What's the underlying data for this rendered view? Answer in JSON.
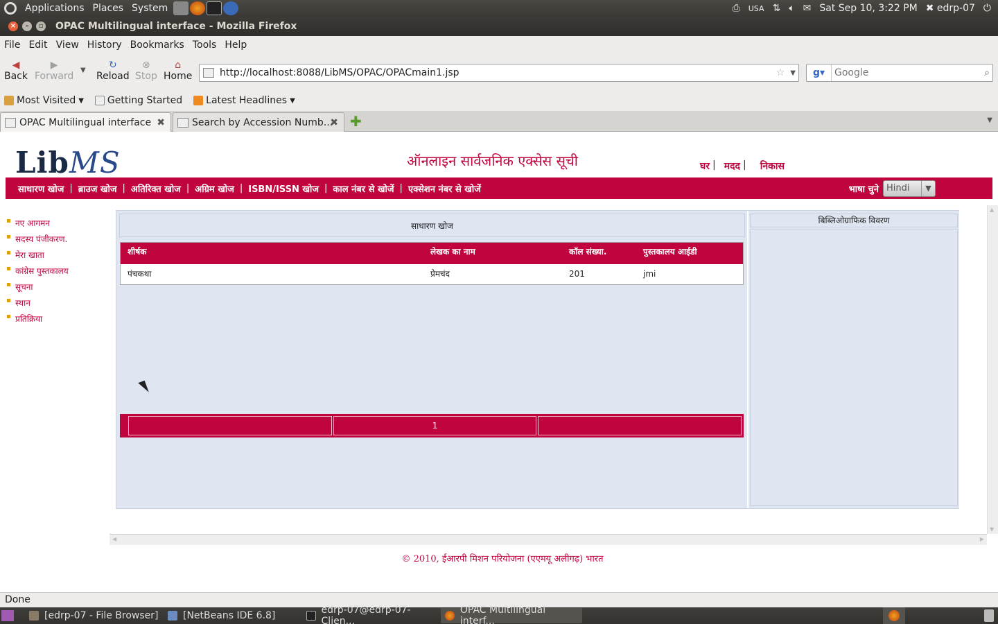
{
  "top_panel": {
    "menus": [
      "Applications",
      "Places",
      "System"
    ],
    "keyboard_layout": "USA",
    "datetime": "Sat Sep 10,  3:22 PM",
    "user": "edrp-07"
  },
  "window": {
    "title": "OPAC Multilingual interface - Mozilla Firefox"
  },
  "firefox": {
    "menu": [
      "File",
      "Edit",
      "View",
      "History",
      "Bookmarks",
      "Tools",
      "Help"
    ],
    "nav": {
      "back": "Back",
      "forward": "Forward",
      "reload": "Reload",
      "stop": "Stop",
      "home": "Home"
    },
    "url": "http://localhost:8088/LibMS/OPAC/OPACmain1.jsp",
    "search_placeholder": "Google",
    "bookmarks": [
      "Most Visited",
      "Getting Started",
      "Latest Headlines"
    ],
    "tabs": [
      {
        "label": "OPAC Multilingual interface",
        "active": true
      },
      {
        "label": "Search by Accession Numb...",
        "active": false
      }
    ],
    "status": "Done"
  },
  "page": {
    "logo": {
      "lib": "Lib",
      "ms": "MS"
    },
    "title": "ऑनलाइन सार्वजनिक एक्सेस सूची",
    "top_links": [
      "घर",
      "मदद",
      "निकास"
    ],
    "nav": [
      "साधारण खोज",
      "ब्राउज खोज",
      "अतिरिक्त खोज",
      "अग्रिम खोज",
      "ISBN/ISSN खोज",
      "काल नंबर से खोजें",
      "एक्सेशन नंबर से खोजें"
    ],
    "language_label": "भाषा चुने",
    "language_selected": "Hindi",
    "sidebar": [
      "नए आगमन",
      "सदस्य पंजीकरण.",
      "मेरा खाता",
      "कांग्रेस पुस्तकालय",
      "सूचना",
      "स्थान",
      "प्रतिक्रिया"
    ],
    "search_header": "साधारण खोज",
    "results": {
      "columns": [
        "शीर्षक",
        "लेखक का नाम",
        "कॉल संख्या.",
        "पुस्तकालय आईडी"
      ],
      "rows": [
        [
          "पंचकथा",
          "प्रेमचंद",
          "201",
          "jmi"
        ]
      ]
    },
    "pager": [
      "",
      "1",
      ""
    ],
    "biblio_header": "बिब्लिओग्राफिक विवरण",
    "footer": "© 2010, ईआरपी मिशन परियोजना (एएमयू अलीगढ़) भारत"
  },
  "taskbar": [
    "[edrp-07 - File Browser]",
    "[NetBeans IDE 6.8]",
    "edrp-07@edrp-07-Clien...",
    "OPAC Multilingual interf..."
  ],
  "colors": {
    "accent": "#c0053e",
    "panel_bg": "#dfe6f2"
  }
}
